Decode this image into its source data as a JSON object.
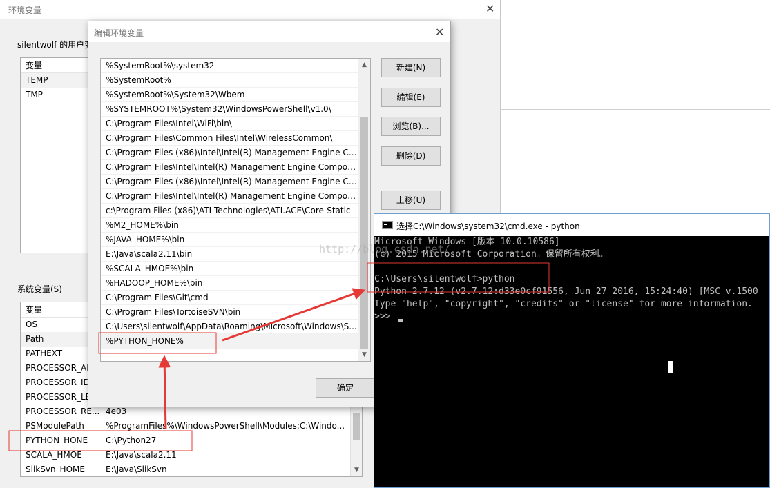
{
  "env_window": {
    "title": "环境变量",
    "user_vars_label": "silentwolf 的用户变",
    "user_table": {
      "header": "变量",
      "rows": [
        "TEMP",
        "TMP"
      ]
    },
    "sys_vars_label": "系统变量(S)",
    "sys_table": {
      "header": "变量",
      "rows": [
        {
          "name": "OS",
          "value": ""
        },
        {
          "name": "Path",
          "value": ""
        },
        {
          "name": "PATHEXT",
          "value": ""
        },
        {
          "name": "PROCESSOR_AR",
          "value": ""
        },
        {
          "name": "PROCESSOR_ID",
          "value": ""
        },
        {
          "name": "PROCESSOR_LE",
          "value": ""
        },
        {
          "name": "PROCESSOR_RE...",
          "value": "4e03"
        },
        {
          "name": "PSModulePath",
          "value": "%ProgramFiles%\\WindowsPowerShell\\Modules;C:\\Windo..."
        },
        {
          "name": "PYTHON_HONE",
          "value": "C:\\Python27"
        },
        {
          "name": "SCALA_HMOE",
          "value": "E:\\Java\\scala2.11"
        },
        {
          "name": "SlikSvn_HOME",
          "value": "E:\\Java\\SlikSvn"
        }
      ]
    }
  },
  "edit_window": {
    "title": "编辑环境变量",
    "paths": [
      "%SystemRoot%\\system32",
      "%SystemRoot%",
      "%SystemRoot%\\System32\\Wbem",
      "%SYSTEMROOT%\\System32\\WindowsPowerShell\\v1.0\\",
      "C:\\Program Files\\Intel\\WiFi\\bin\\",
      "C:\\Program Files\\Common Files\\Intel\\WirelessCommon\\",
      "C:\\Program Files (x86)\\Intel\\Intel(R) Management Engine Co...",
      "C:\\Program Files\\Intel\\Intel(R) Management Engine Compon...",
      "C:\\Program Files (x86)\\Intel\\Intel(R) Management Engine Co...",
      "C:\\Program Files\\Intel\\Intel(R) Management Engine Compon...",
      "c:\\Program Files (x86)\\ATI Technologies\\ATI.ACE\\Core-Static",
      "%M2_HOME%\\bin",
      "%JAVA_HOME%\\bin",
      "E:\\Java\\scala2.11\\bin",
      "%SCALA_HMOE%\\bin",
      "%HADOOP_HOME%\\bin",
      "C:\\Program Files\\Git\\cmd",
      "C:\\Program Files\\TortoiseSVN\\bin",
      "C:\\Users\\silentwolf\\AppData\\Roaming\\Microsoft\\Windows\\S...",
      "%PYTHON_HONE%"
    ],
    "buttons": {
      "new": "新建(N)",
      "edit": "编辑(E)",
      "browse": "浏览(B)...",
      "delete": "删除(D)",
      "move_up": "上移(U)",
      "ok": "确定"
    }
  },
  "cmd_window": {
    "title": "选择C:\\Windows\\system32\\cmd.exe - python",
    "lines": [
      "Microsoft Windows [版本 10.0.10586]",
      "(c) 2015 Microsoft Corporation。保留所有权利。",
      "",
      "C:\\Users\\silentwolf>python",
      "Python 2.7.12 (v2.7.12:d33e0cf91556, Jun 27 2016, 15:24:40) [MSC v.1500",
      "Type \"help\", \"copyright\", \"credits\" or \"license\" for more information.",
      ">>> "
    ]
  },
  "watermark": "http://blog.csdn.net/",
  "colors": {
    "annotation_red": "#e53935",
    "console_bg": "#000000",
    "console_text": "#c0c0c0"
  }
}
